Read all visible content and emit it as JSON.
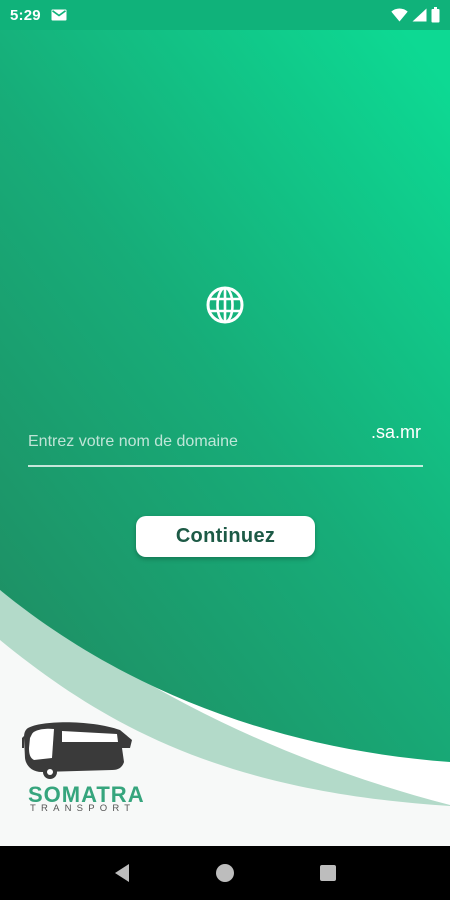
{
  "status_bar": {
    "time": "5:29",
    "icons": [
      "mail-icon",
      "wifi-icon",
      "signal-icon",
      "battery-icon"
    ]
  },
  "main": {
    "icon": "globe-icon",
    "domain_field": {
      "value": "",
      "placeholder": "Entrez votre nom de domaine",
      "suffix": ".sa.mr"
    },
    "continue_label": "Continuez"
  },
  "logo": {
    "name": "SOMATRA",
    "subtitle": "TRANSPORT"
  },
  "nav_bar": {
    "buttons": [
      "back-icon",
      "home-icon",
      "recents-icon"
    ]
  },
  "colors": {
    "gradient_top": "#0dd993",
    "gradient_bottom": "#1f8c62",
    "light_wave": "#b3dac9",
    "button_text": "#1d5a46",
    "logo_green": "#36a57d"
  }
}
